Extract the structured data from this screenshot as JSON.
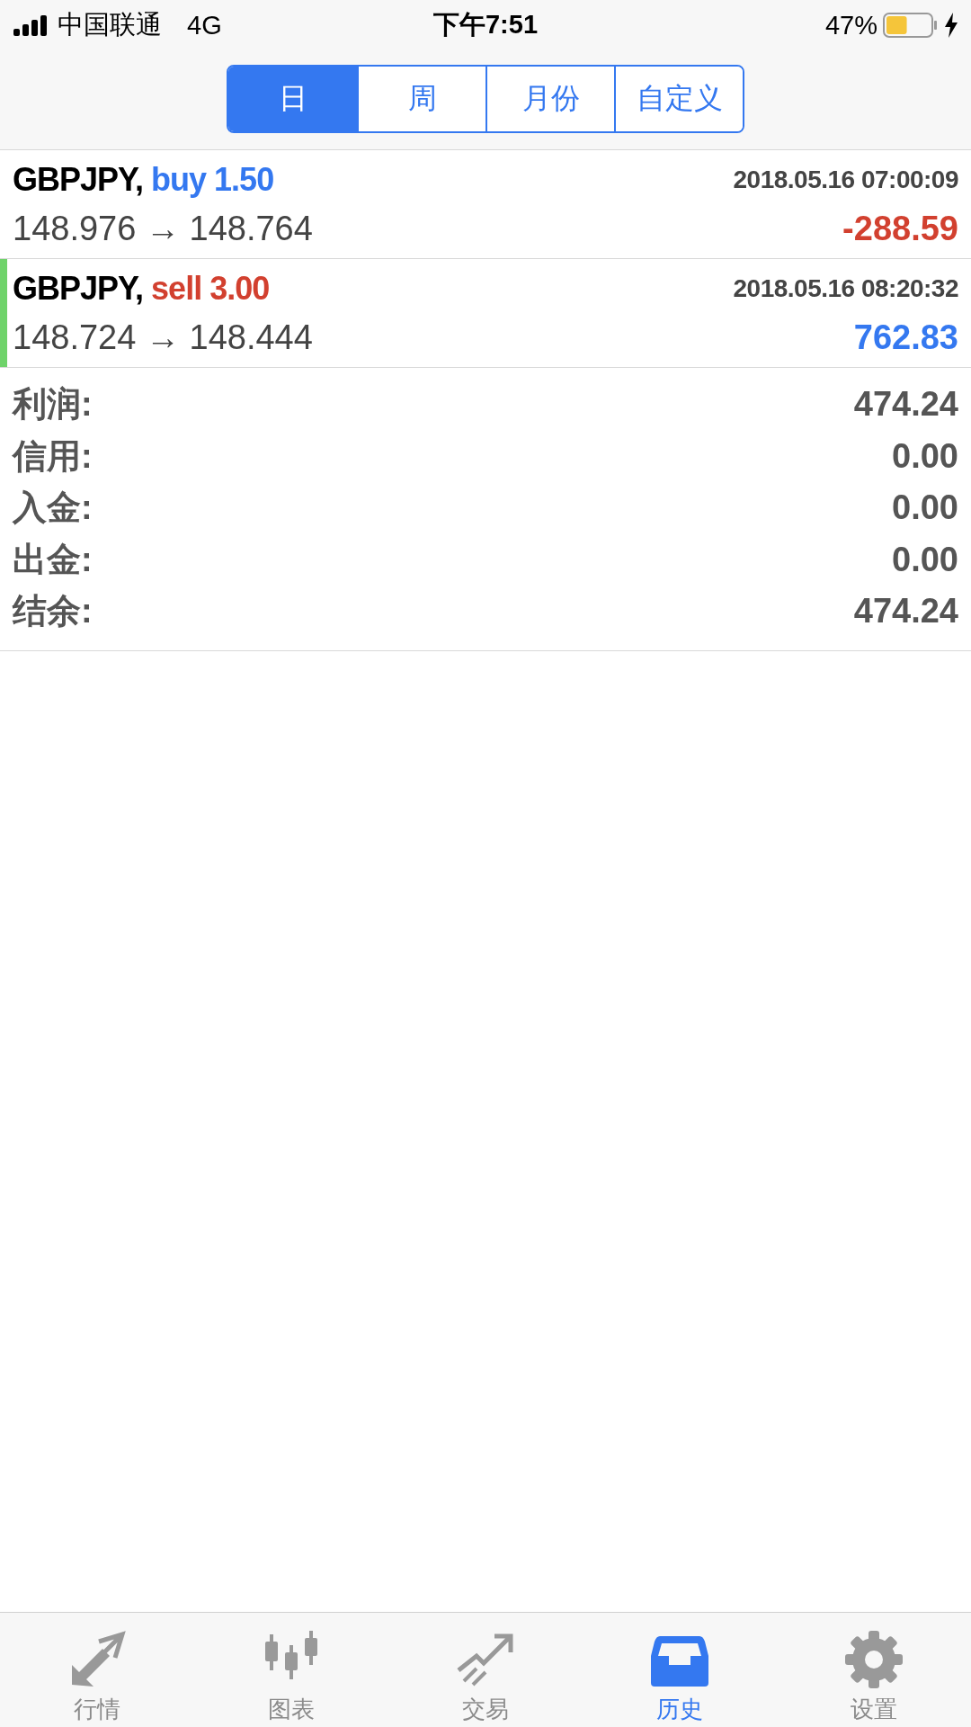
{
  "status_bar": {
    "carrier": "中国联通",
    "network": "4G",
    "time": "下午7:51",
    "battery": "47%",
    "charging": true
  },
  "period_tabs": [
    {
      "label": "日",
      "selected": true
    },
    {
      "label": "周",
      "selected": false
    },
    {
      "label": "月份",
      "selected": false
    },
    {
      "label": "自定义",
      "selected": false
    }
  ],
  "trades": [
    {
      "symbol": "GBPJPY,",
      "side": {
        "text": "buy 1.50",
        "color": "#3478f0"
      },
      "time": "2018.05.16 07:00:09",
      "open_price": "148.976",
      "arrow": "→",
      "close_price": "148.764",
      "profit": {
        "text": "-288.59",
        "color": "#d2402f"
      },
      "selected": false
    },
    {
      "symbol": "GBPJPY,",
      "side": {
        "text": "sell 3.00",
        "color": "#d2402f"
      },
      "time": "2018.05.16 08:20:32",
      "open_price": "148.724",
      "arrow": "→",
      "close_price": "148.444",
      "profit": {
        "text": "762.83",
        "color": "#3478f0"
      },
      "selected": true
    }
  ],
  "summary": [
    {
      "label": "利润:",
      "value": "474.24"
    },
    {
      "label": "信用:",
      "value": "0.00"
    },
    {
      "label": "入金:",
      "value": "0.00"
    },
    {
      "label": "出金:",
      "value": "0.00"
    },
    {
      "label": "结余:",
      "value": "474.24"
    }
  ],
  "tab_bar": [
    {
      "label": "行情",
      "kind": "quotes",
      "selected": false
    },
    {
      "label": "图表",
      "kind": "chart",
      "selected": false
    },
    {
      "label": "交易",
      "kind": "trade",
      "selected": false
    },
    {
      "label": "历史",
      "kind": "history",
      "selected": true
    },
    {
      "label": "设置",
      "kind": "settings",
      "selected": false
    }
  ]
}
